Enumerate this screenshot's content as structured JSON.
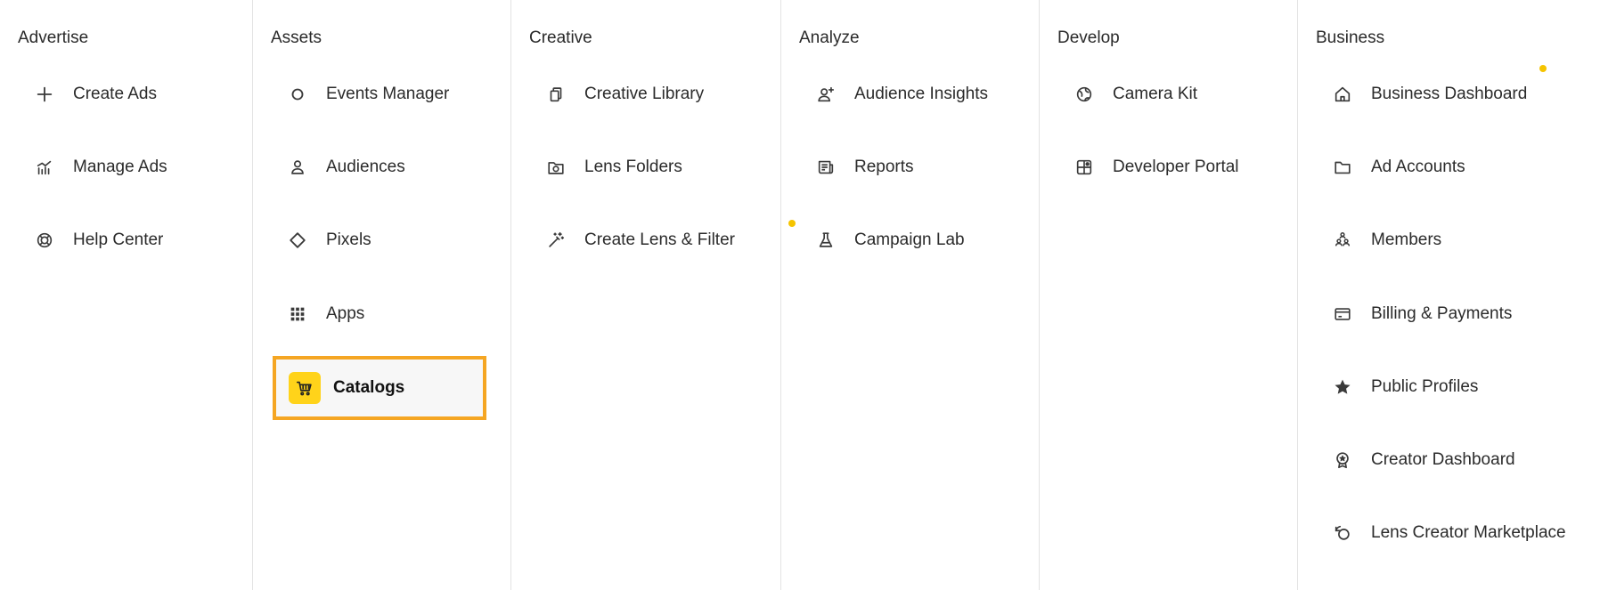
{
  "columns": [
    {
      "heading": "Advertise",
      "items": [
        {
          "label": "Create Ads",
          "icon": "plus-icon"
        },
        {
          "label": "Manage Ads",
          "icon": "bar-chart-icon"
        },
        {
          "label": "Help Center",
          "icon": "lifebuoy-icon"
        }
      ]
    },
    {
      "heading": "Assets",
      "items": [
        {
          "label": "Events Manager",
          "icon": "circle-icon"
        },
        {
          "label": "Audiences",
          "icon": "person-icon"
        },
        {
          "label": "Pixels",
          "icon": "diamond-icon"
        },
        {
          "label": "Apps",
          "icon": "grid-icon"
        },
        {
          "label": "Catalogs",
          "icon": "cart-icon",
          "selected": true
        }
      ]
    },
    {
      "heading": "Creative",
      "items": [
        {
          "label": "Creative Library",
          "icon": "stacked-cards-icon"
        },
        {
          "label": "Lens Folders",
          "icon": "camera-folder-icon"
        },
        {
          "label": "Create Lens & Filter",
          "icon": "magic-wand-icon",
          "badge": true
        }
      ]
    },
    {
      "heading": "Analyze",
      "items": [
        {
          "label": "Audience Insights",
          "icon": "person-plus-icon"
        },
        {
          "label": "Reports",
          "icon": "newspaper-icon"
        },
        {
          "label": "Campaign Lab",
          "icon": "flask-icon"
        }
      ]
    },
    {
      "heading": "Develop",
      "items": [
        {
          "label": "Camera Kit",
          "icon": "globe-icon"
        },
        {
          "label": "Developer Portal",
          "icon": "puzzle-box-icon"
        }
      ]
    },
    {
      "heading": "Business",
      "items": [
        {
          "label": "Business Dashboard",
          "icon": "home-icon",
          "badge": true
        },
        {
          "label": "Ad Accounts",
          "icon": "folder-icon"
        },
        {
          "label": "Members",
          "icon": "people-stack-icon"
        },
        {
          "label": "Billing & Payments",
          "icon": "credit-card-icon"
        },
        {
          "label": "Public Profiles",
          "icon": "star-icon"
        },
        {
          "label": "Creator Dashboard",
          "icon": "award-icon"
        },
        {
          "label": "Lens Creator Marketplace",
          "icon": "lens-cycle-icon"
        }
      ]
    }
  ],
  "colors": {
    "accent": "#f5c400",
    "selection_outline": "#f5a623",
    "divider": "#e3e3e3"
  }
}
